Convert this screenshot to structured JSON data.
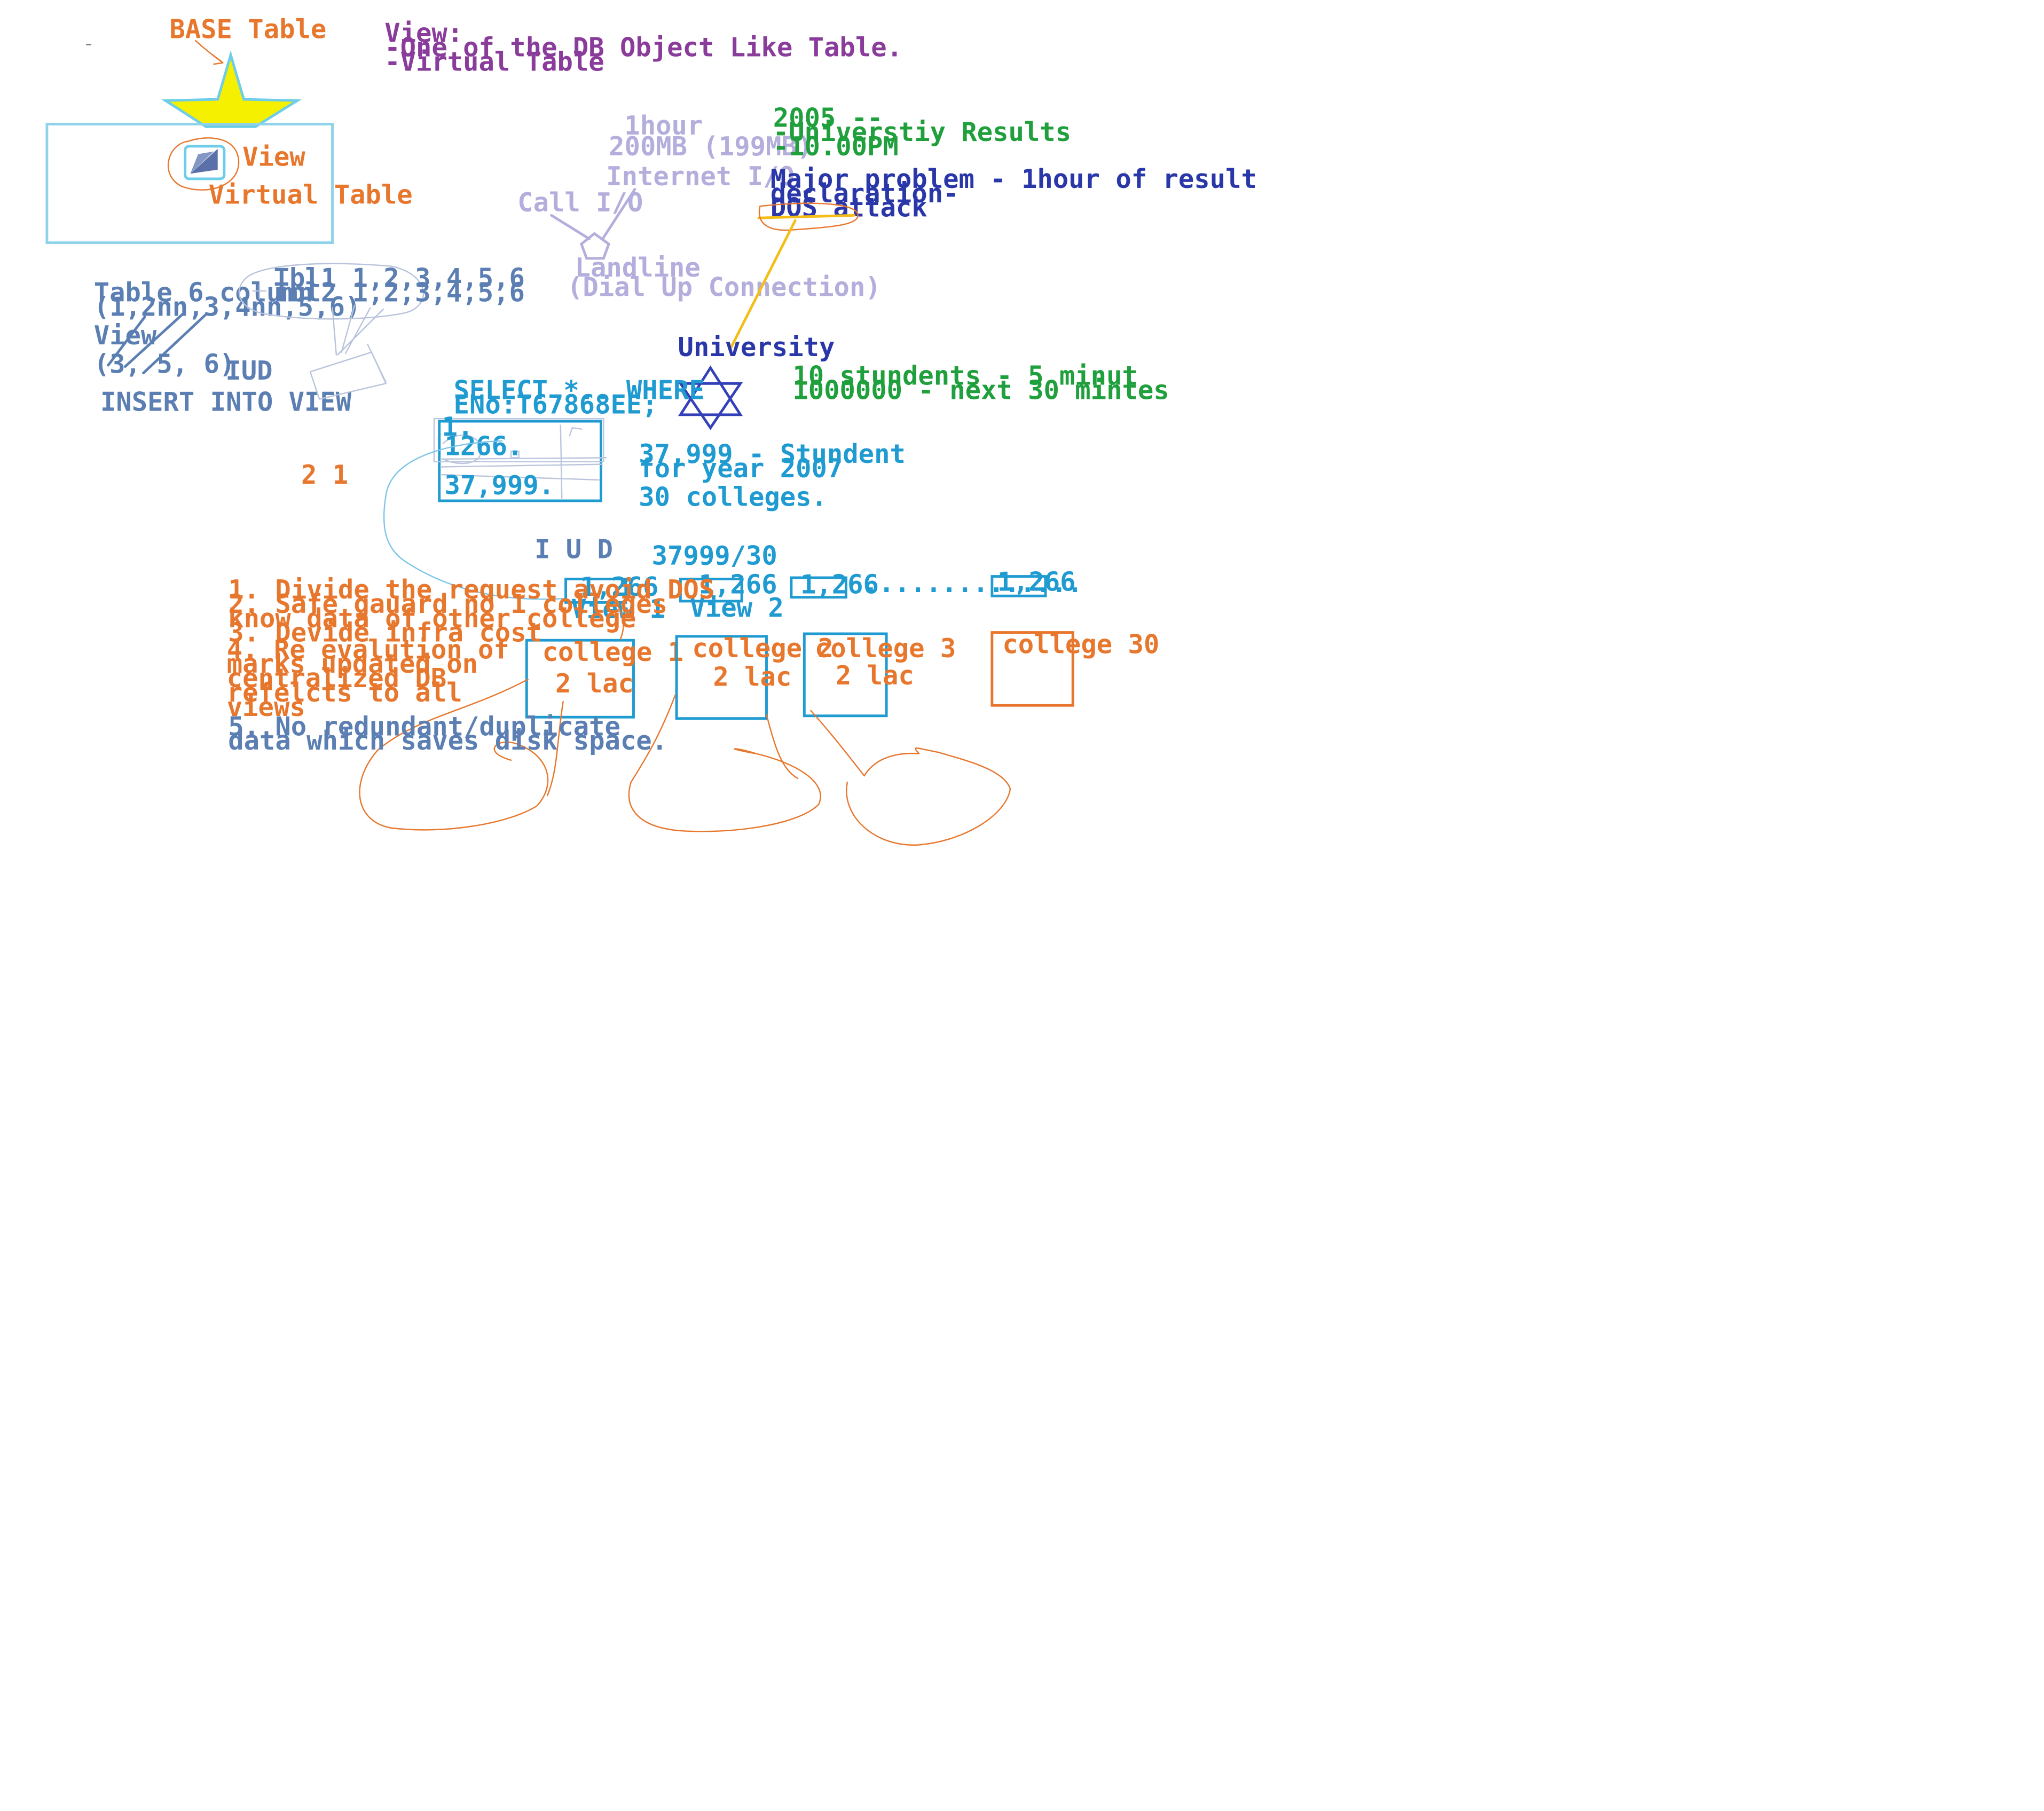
{
  "palette": {
    "orange": "#e8772e",
    "purple": "#8a3c9b",
    "green": "#1fa03c",
    "blue": "#1f9bd1",
    "steel": "#5c7fb3",
    "lavender": "#b3aedb",
    "navy": "#2a37a8",
    "yellow": "#f5f000",
    "gold": "#f4bd18",
    "light_blue_border": "#8fd3ea"
  },
  "icons": [
    "star-icon",
    "view-icon",
    "pentagon-icon",
    "star-of-david-icon"
  ],
  "base_table": {
    "label": "BASE Table",
    "view_label": "View",
    "virtual_label": "Virtual Table"
  },
  "view_definition": {
    "line1": "View:",
    "line2": "-One of the DB Object Like Table.",
    "line3": "-Virtual Table"
  },
  "table_notes": {
    "line1": "Table 6 column",
    "line2": "(1,2nn,3,4nn,5,6)",
    "line3": "View",
    "line4": "(3, 5, 6)",
    "line5": "INSERT INTO VIEW",
    "iud": "IUD",
    "tbl1": "Tbl1  1,2,3,4,5,6",
    "tbl2": "Tbl2  1,2,3,4,5,6"
  },
  "connection": {
    "line1": "1hour",
    "line2": "200MB (199MB)",
    "line3": "Internet I/O",
    "call": "Call I/O",
    "landline": "Landline",
    "dialup": "(Dial Up Connection)"
  },
  "results": {
    "line1": "2005 --",
    "line2": "-Universtiy Results",
    "line3": "-10.00PM"
  },
  "problem": {
    "line1": "Major problem - 1hour of result",
    "line2": "declaration-",
    "line3": "DOS attack"
  },
  "university": {
    "label": "University",
    "stat1": "10 stundents - 5 minut",
    "stat2": "1000000  - next 30 mintes"
  },
  "query": {
    "line1": "SELECT *.. WHERE",
    "line2": "ENo:T67868EE;",
    "row1": "1.",
    "row2": "1266.",
    "row3": "37,999.",
    "note1": "37,999  - Stundent",
    "note2": "for year 2007",
    "note3": "30 colleges.",
    "stray": "2 1"
  },
  "views": {
    "iud": "I U D",
    "division": "37999/30",
    "count1": "1,266",
    "count2": "1,266",
    "count3": "1,266",
    "count30": "1,266",
    "dots": "..............",
    "view1": "View 1",
    "view2": "View 2"
  },
  "colleges": {
    "c1": "college 1",
    "c2": "college 2",
    "c3": "college 3",
    "c30": "college 30",
    "lac1": "2 lac",
    "lac2": "2 lac",
    "lac3": "2 lac"
  },
  "benefits": {
    "b1": "1. Divide the request avoid DOS",
    "b2a": "2. Safe gauard no 1 colleges",
    "b2b": "know data of other college",
    "b3": "3. Devide infra cost",
    "b4a": "4. Re evalution of",
    "b4b": "marks updated on",
    "b4c": "centralized DB",
    "b4d": "refelcts to all",
    "b4e": "views",
    "b5a": "5. No redundant/duplicate",
    "b5b": "data which saves disk space."
  }
}
